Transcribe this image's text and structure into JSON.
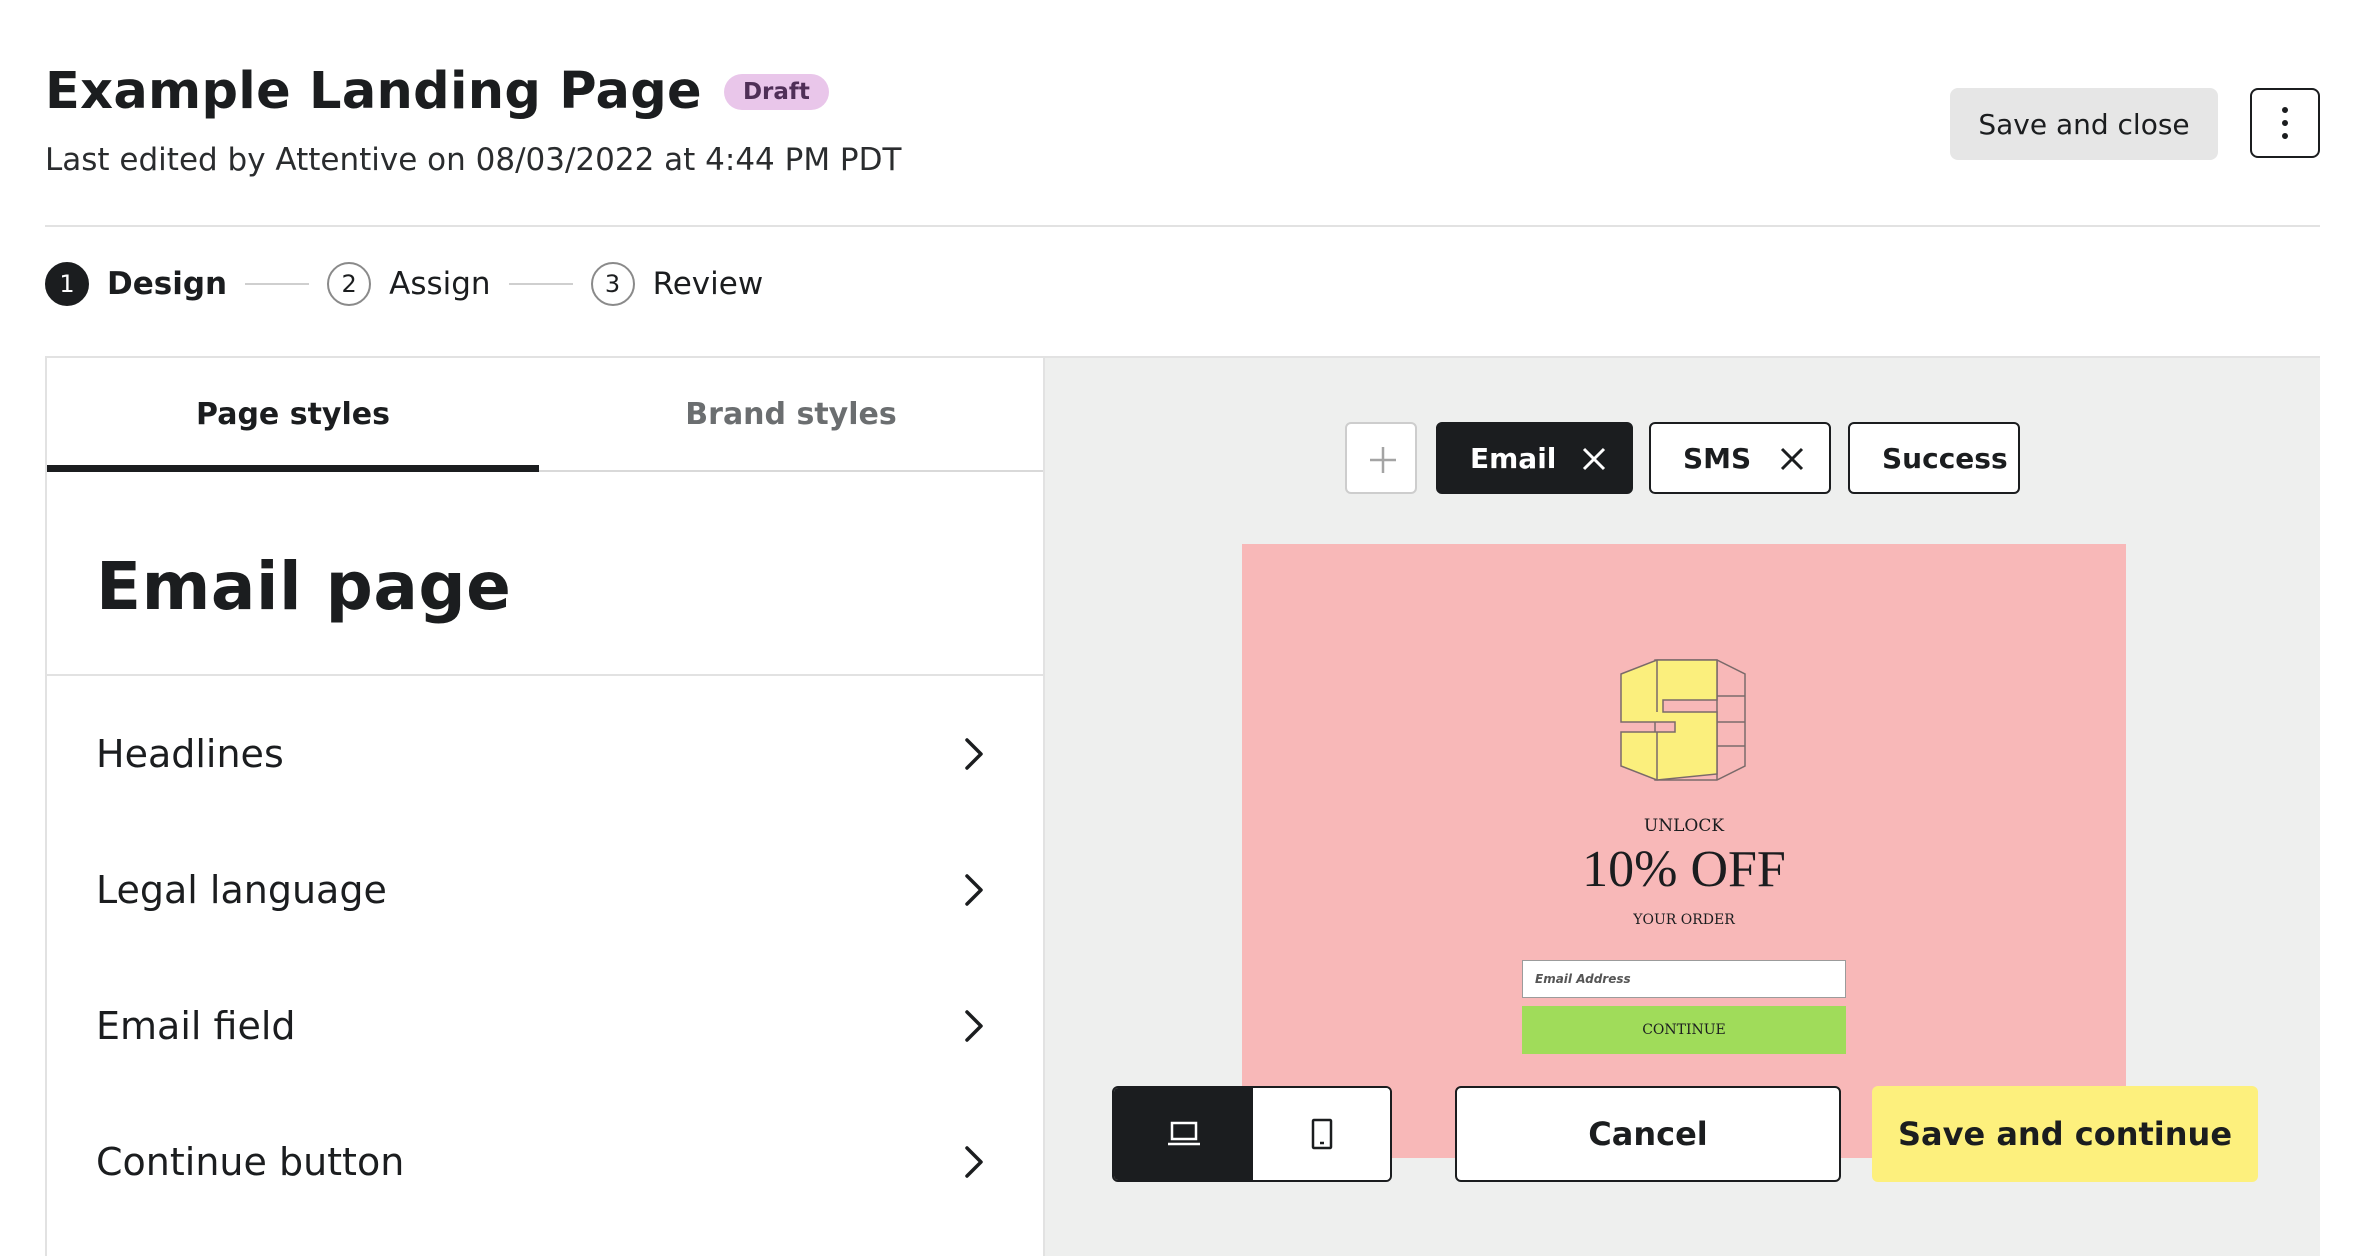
{
  "header": {
    "title": "Example Landing Page",
    "badge": "Draft",
    "subtitle": "Last edited by Attentive on 08/03/2022 at 4:44 PM PDT",
    "save_close_label": "Save and close",
    "more_icon": "more-vertical-icon"
  },
  "stepper": {
    "steps": [
      {
        "number": "1",
        "label": "Design",
        "active": true
      },
      {
        "number": "2",
        "label": "Assign",
        "active": false
      },
      {
        "number": "3",
        "label": "Review",
        "active": false
      }
    ]
  },
  "left_panel": {
    "tabs": [
      {
        "label": "Page styles",
        "active": true
      },
      {
        "label": "Brand styles",
        "active": false
      }
    ],
    "section_title": "Email page",
    "items": [
      {
        "label": "Headlines"
      },
      {
        "label": "Legal language"
      },
      {
        "label": "Email field"
      },
      {
        "label": "Continue button"
      }
    ]
  },
  "right_panel": {
    "page_chips": [
      {
        "label": "Email",
        "selected": true,
        "removable": true
      },
      {
        "label": "SMS",
        "selected": false,
        "removable": true
      },
      {
        "label": "Success",
        "selected": false,
        "removable": false
      }
    ],
    "preview": {
      "background": "#f8b8b8",
      "eyebrow": "UNLOCK",
      "headline": "10% OFF",
      "sub": "YOUR ORDER",
      "email_placeholder": "Email Address",
      "button_label": "CONTINUE",
      "button_color": "#a0dc5a",
      "logo_color": "#fbef7d"
    },
    "device_toggle": {
      "selected": "desktop",
      "options": [
        "desktop-icon",
        "mobile-icon"
      ]
    },
    "cancel_label": "Cancel",
    "save_continue_label": "Save and continue"
  },
  "colors": {
    "primary_dark": "#1b1d1f",
    "accent_yellow": "#fdf07d",
    "badge_bg": "#e9c6ea"
  }
}
